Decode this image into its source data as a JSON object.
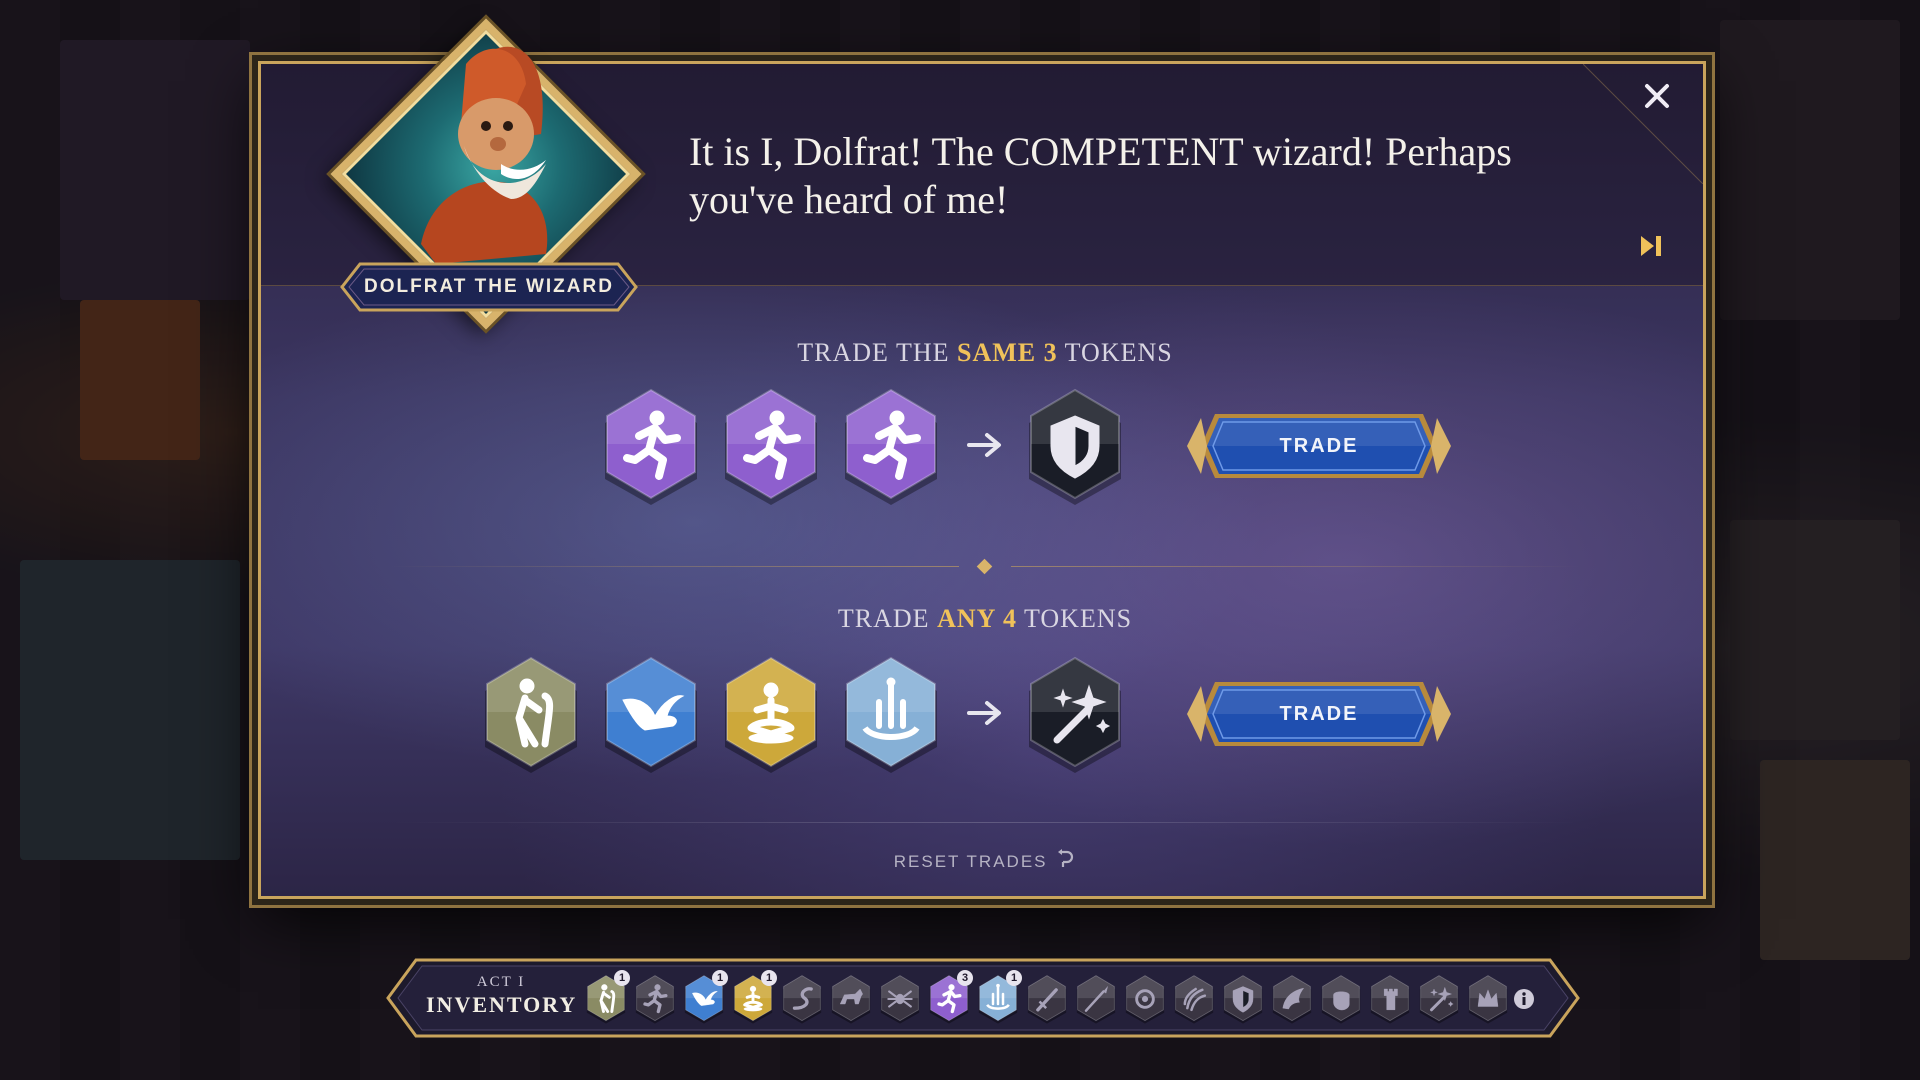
{
  "dialog": {
    "speaker_name": "DOLFRAT THE WIZARD",
    "line": "It is I, Dolfrat! The COMPETENT wizard! Perhaps you've heard of me!",
    "close_icon": "close-icon",
    "skip_icon": "skip-forward-icon"
  },
  "trade_same": {
    "title_prefix": "TRADE THE ",
    "title_highlight": "SAME 3",
    "title_suffix": " TOKENS",
    "inputs": [
      {
        "icon": "running-figure-icon",
        "color": "#8e5fce"
      },
      {
        "icon": "running-figure-icon",
        "color": "#8e5fce"
      },
      {
        "icon": "running-figure-icon",
        "color": "#8e5fce"
      }
    ],
    "output": {
      "icon": "shield-icon",
      "color": "#1a1d27"
    },
    "button_label": "TRADE"
  },
  "trade_any": {
    "title_prefix": "TRADE ",
    "title_highlight": "ANY 4",
    "title_suffix": " TOKENS",
    "inputs": [
      {
        "icon": "hiker-icon",
        "color": "#8a8b64"
      },
      {
        "icon": "bird-icon",
        "color": "#3f7fd1"
      },
      {
        "icon": "meditating-figure-icon",
        "color": "#cda83a"
      },
      {
        "icon": "fountain-icon",
        "color": "#86b0d6"
      }
    ],
    "output": {
      "icon": "magic-wand-icon",
      "color": "#1a1d27"
    },
    "button_label": "TRADE"
  },
  "reset_label": "RESET TRADES",
  "inventory": {
    "act_label": "ACT I",
    "title": "INVENTORY",
    "slots": [
      {
        "icon": "hiker-icon",
        "color": "#8a8b64",
        "count": "1",
        "owned": true
      },
      {
        "icon": "running-figure-icon",
        "color": "#3a3542",
        "count": "",
        "owned": false
      },
      {
        "icon": "bird-icon",
        "color": "#3f7fd1",
        "count": "1",
        "owned": true
      },
      {
        "icon": "meditating-figure-icon",
        "color": "#cda83a",
        "count": "1",
        "owned": true
      },
      {
        "icon": "serpent-icon",
        "color": "#3a3542",
        "count": "",
        "owned": false
      },
      {
        "icon": "wolf-icon",
        "color": "#3a3542",
        "count": "",
        "owned": false
      },
      {
        "icon": "spider-icon",
        "color": "#3a3542",
        "count": "",
        "owned": false
      },
      {
        "icon": "running-figure-icon",
        "color": "#8e5fce",
        "count": "3",
        "owned": true
      },
      {
        "icon": "fountain-icon",
        "color": "#86b0d6",
        "count": "1",
        "owned": true
      },
      {
        "icon": "sword-icon",
        "color": "#3a3542",
        "count": "",
        "owned": false
      },
      {
        "icon": "spear-icon",
        "color": "#3a3542",
        "count": "",
        "owned": false
      },
      {
        "icon": "orb-icon",
        "color": "#3a3542",
        "count": "",
        "owned": false
      },
      {
        "icon": "claw-icon",
        "color": "#3a3542",
        "count": "",
        "owned": false
      },
      {
        "icon": "shield-icon",
        "color": "#3a3542",
        "count": "",
        "owned": false
      },
      {
        "icon": "wing-icon",
        "color": "#3a3542",
        "count": "",
        "owned": false
      },
      {
        "icon": "fist-icon",
        "color": "#3a3542",
        "count": "",
        "owned": false
      },
      {
        "icon": "tower-icon",
        "color": "#3a3542",
        "count": "",
        "owned": false
      },
      {
        "icon": "magic-wand-icon",
        "color": "#3a3542",
        "count": "",
        "owned": false
      },
      {
        "icon": "crown-icon",
        "color": "#3a3542",
        "count": "",
        "owned": false
      }
    ],
    "info_icon": "info-icon"
  },
  "colors": {
    "gold": "#c9a45c",
    "highlight": "#f0c25a",
    "button_blue": "#1f4fb0"
  }
}
